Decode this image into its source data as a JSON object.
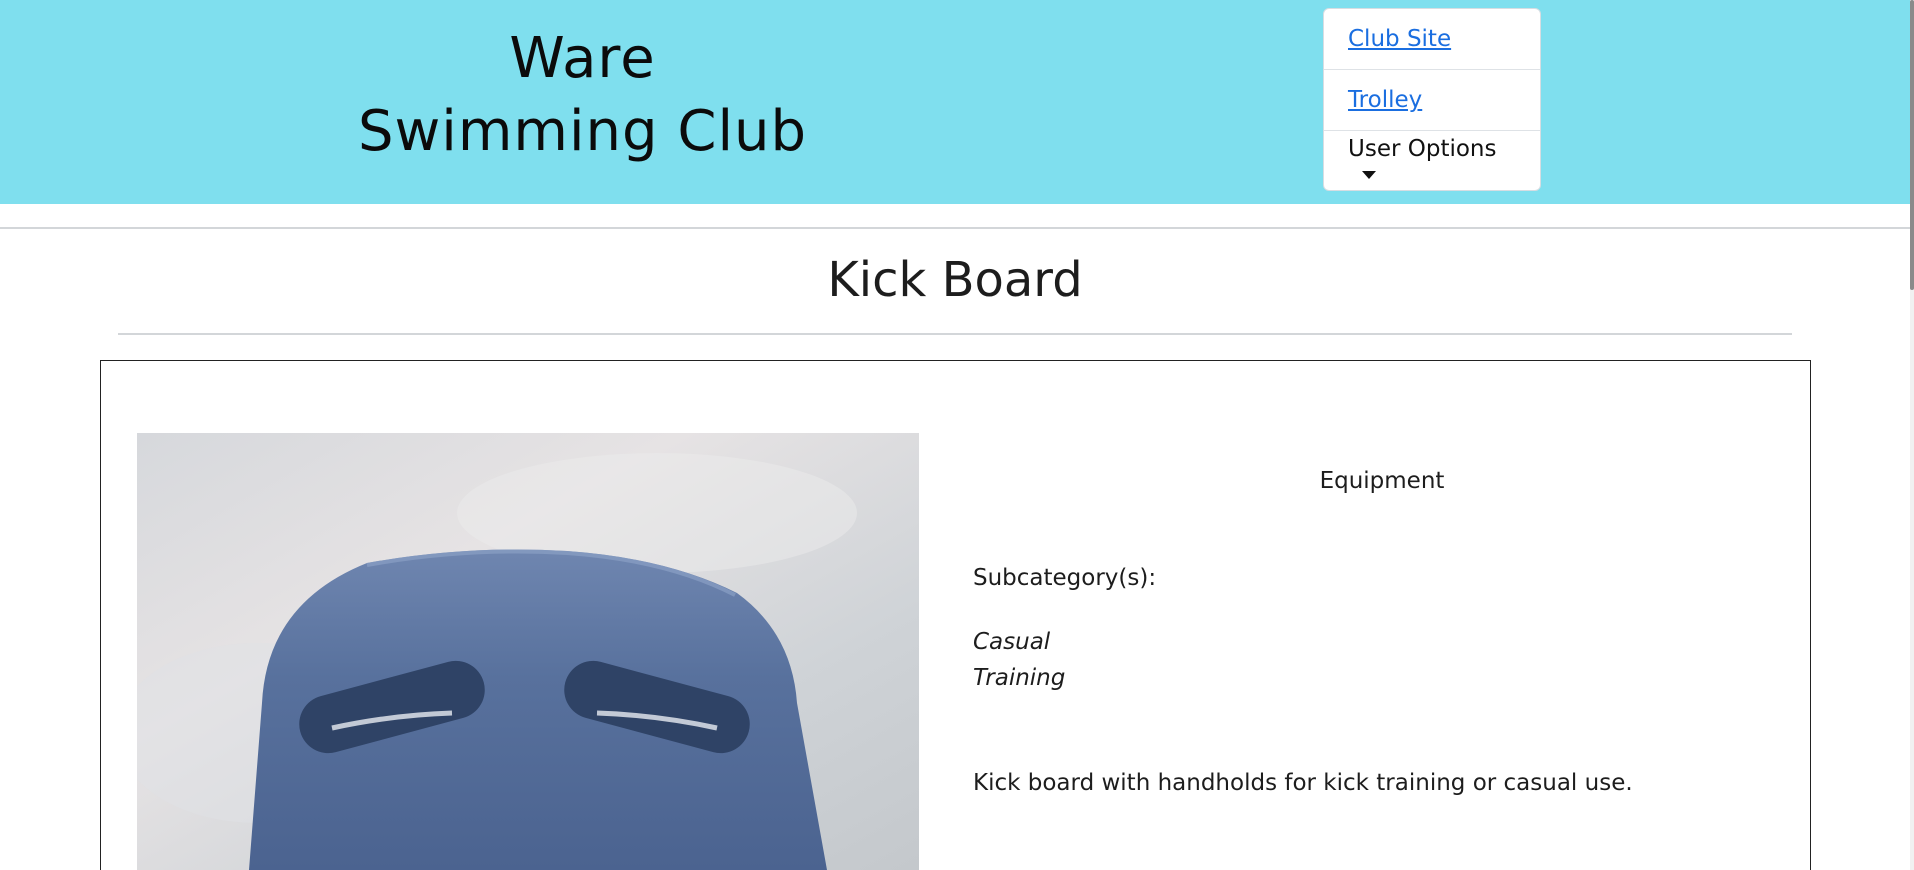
{
  "header": {
    "brand_line1": "Ware",
    "brand_line2": "Swimming Club",
    "nav": {
      "club_site": "Club Site",
      "trolley": "Trolley",
      "user_options": "User Options"
    }
  },
  "product": {
    "title": "Kick Board",
    "category": "Equipment",
    "subcategory_label": "Subcategory(s):",
    "subcategories": [
      "Casual",
      "Training"
    ],
    "description": "Kick board with handholds for kick training or casual use."
  },
  "colors": {
    "header_bg": "#7fdfee",
    "link": "#1a6ee0"
  },
  "icons": [
    "caret-down-icon"
  ]
}
